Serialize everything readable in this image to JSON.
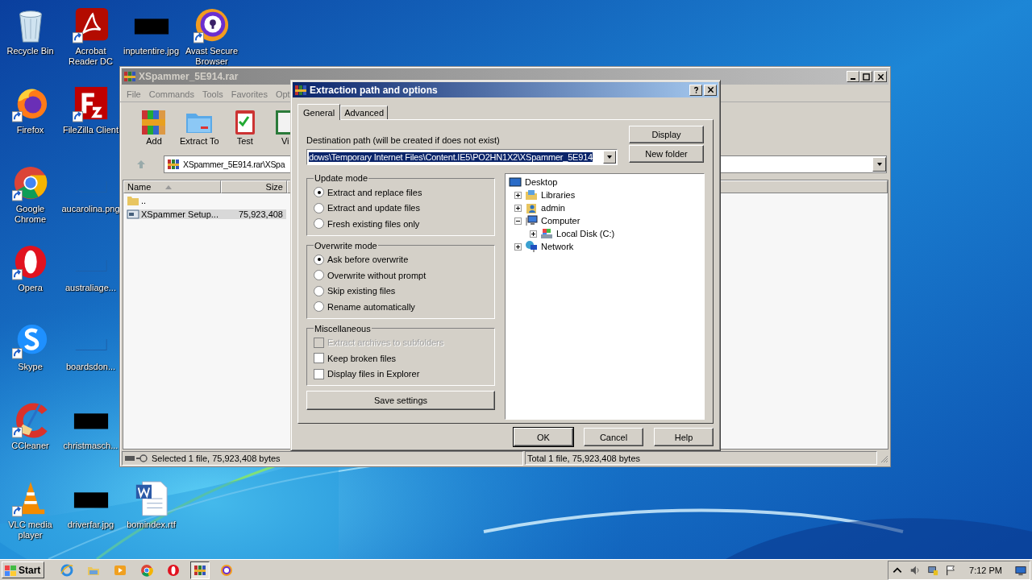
{
  "desktop_icons": [
    {
      "label": "Recycle Bin",
      "kind": "recycle-bin",
      "shortcut": false
    },
    {
      "label": "Acrobat Reader DC",
      "kind": "pdf",
      "shortcut": true
    },
    {
      "label": "inputentire.jpg",
      "kind": "image-dark",
      "shortcut": false
    },
    {
      "label": "Avast Secure Browser",
      "kind": "avast",
      "shortcut": true
    },
    {
      "label": "Firefox",
      "kind": "firefox",
      "shortcut": true
    },
    {
      "label": "FileZilla Client",
      "kind": "filezilla",
      "shortcut": true
    },
    {
      "label": "Google Chrome",
      "kind": "chrome",
      "shortcut": true
    },
    {
      "label": "aucarolina.png",
      "kind": "image-blank",
      "shortcut": false
    },
    {
      "label": "Opera",
      "kind": "opera",
      "shortcut": true
    },
    {
      "label": "australiage...",
      "kind": "image-blank",
      "shortcut": false
    },
    {
      "label": "Skype",
      "kind": "skype",
      "shortcut": true
    },
    {
      "label": "boardsdon...",
      "kind": "image-blank",
      "shortcut": false
    },
    {
      "label": "CCleaner",
      "kind": "ccleaner",
      "shortcut": true
    },
    {
      "label": "christmasch...",
      "kind": "image-dark",
      "shortcut": false
    },
    {
      "label": "VLC media player",
      "kind": "vlc",
      "shortcut": true
    },
    {
      "label": "driverfar.jpg",
      "kind": "image-dark",
      "shortcut": false
    },
    {
      "label": "bomindex.rtf",
      "kind": "word",
      "shortcut": false
    }
  ],
  "archive_window": {
    "title": "XSpammer_5E914.rar",
    "menu": [
      "File",
      "Commands",
      "Tools",
      "Favorites",
      "Opt"
    ],
    "toolbar": [
      {
        "label": "Add",
        "kind": "add"
      },
      {
        "label": "Extract To",
        "kind": "extract"
      },
      {
        "label": "Test",
        "kind": "test"
      },
      {
        "label": "Vi",
        "kind": "view"
      }
    ],
    "address": "XSpammer_5E914.rar\\XSpa",
    "columns": [
      "Name",
      "Size"
    ],
    "rows": [
      {
        "name": "..",
        "kind": "parent",
        "selected": false
      },
      {
        "name": "XSpammer Setup...",
        "size": "75,923,408",
        "kind": "file",
        "selected": true
      }
    ],
    "status": [
      "Selected 1 file, 75,923,408 bytes",
      "Total 1 file, 75,923,408 bytes"
    ]
  },
  "dialog": {
    "title": "Extraction path and options",
    "tabs": [
      {
        "label": "General",
        "selected": true
      },
      {
        "label": "Advanced",
        "selected": false
      }
    ],
    "destination_label": "Destination path (will be created if does not exist)",
    "destination_value": "dows\\Temporary Internet Files\\Content.IE5\\PO2HN1X2\\XSpammer_5E914",
    "side_buttons": [
      "Display",
      "New folder"
    ],
    "groups": [
      {
        "title": "Update mode",
        "kind": "radio",
        "options": [
          {
            "label": "Extract and replace files",
            "selected": true
          },
          {
            "label": "Extract and update files",
            "selected": false
          },
          {
            "label": "Fresh existing files only",
            "selected": false
          }
        ]
      },
      {
        "title": "Overwrite mode",
        "kind": "radio",
        "options": [
          {
            "label": "Ask before overwrite",
            "selected": true
          },
          {
            "label": "Overwrite without prompt",
            "selected": false
          },
          {
            "label": "Skip existing files",
            "selected": false
          },
          {
            "label": "Rename automatically",
            "selected": false
          }
        ]
      },
      {
        "title": "Miscellaneous",
        "kind": "check",
        "options": [
          {
            "label": "Extract archives to subfolders",
            "checked": false,
            "disabled": true
          },
          {
            "label": "Keep broken files",
            "checked": false,
            "disabled": false
          },
          {
            "label": "Display files in Explorer",
            "checked": false,
            "disabled": false
          }
        ]
      }
    ],
    "save_button": "Save settings",
    "tree": [
      {
        "label": "Desktop",
        "kind": "desktop",
        "children": [
          {
            "label": "Libraries",
            "kind": "libraries",
            "expanded": false
          },
          {
            "label": "admin",
            "kind": "user",
            "expanded": false
          },
          {
            "label": "Computer",
            "kind": "computer",
            "expanded": true,
            "children": [
              {
                "label": "Local Disk (C:)",
                "kind": "disk",
                "expanded": false
              }
            ]
          },
          {
            "label": "Network",
            "kind": "network",
            "expanded": false
          }
        ]
      }
    ],
    "buttons": [
      {
        "label": "OK",
        "default": true
      },
      {
        "label": "Cancel",
        "default": false
      },
      {
        "label": "Help",
        "default": false
      }
    ]
  },
  "taskbar": {
    "start": "Start",
    "apps": [
      {
        "kind": "ie",
        "active": false
      },
      {
        "kind": "explorer",
        "active": false
      },
      {
        "kind": "media",
        "active": false
      },
      {
        "kind": "chrome",
        "active": false
      },
      {
        "kind": "opera",
        "active": false
      },
      {
        "kind": "winrar",
        "active": true
      },
      {
        "kind": "avast",
        "active": false
      }
    ],
    "clock": "7:12 PM"
  }
}
